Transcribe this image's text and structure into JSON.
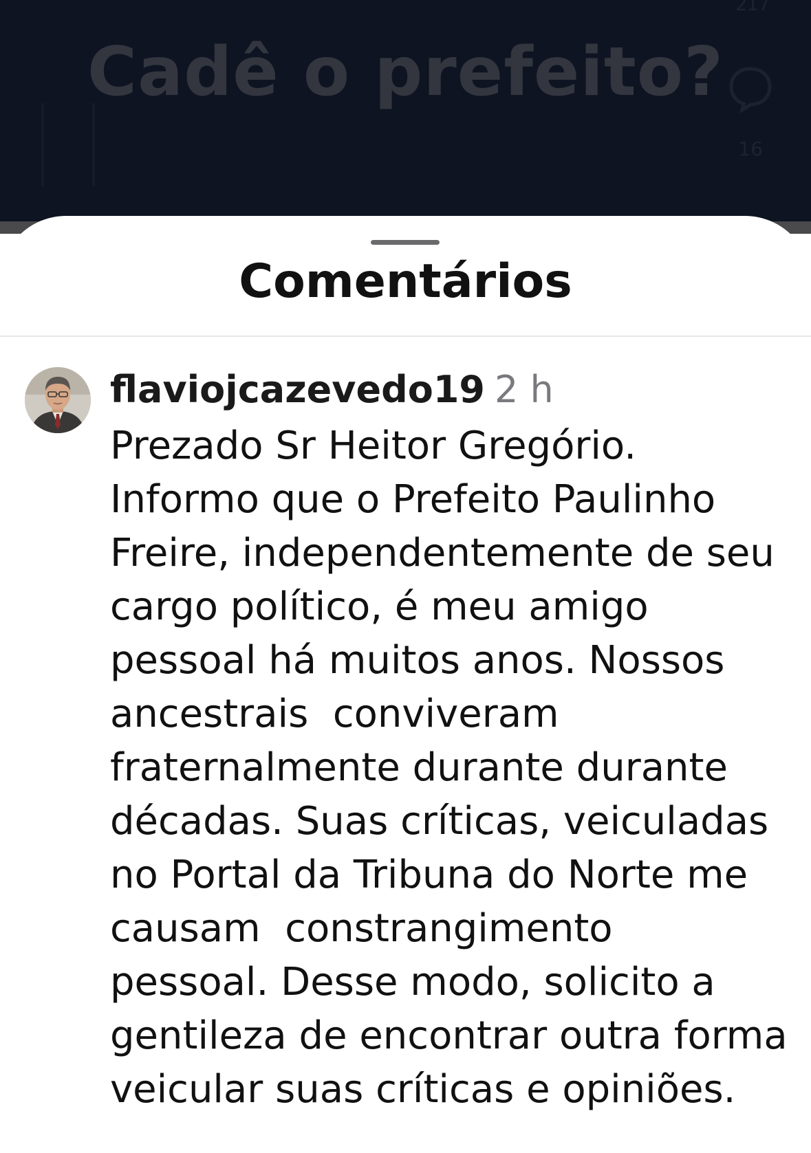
{
  "post": {
    "title": "Cadê o prefeito?",
    "count_top": "217",
    "count_bottom": "16",
    "comment_icon": "speech-bubble-icon"
  },
  "sheet": {
    "title": "Comentários"
  },
  "comment": {
    "username": "flaviojcazevedo19",
    "time": "2 h",
    "avatar": "user-photo-avatar",
    "lines": [
      "Prezado Sr Heitor Gregório.",
      "Informo que o Prefeito Paulinho",
      "Freire, independentemente de seu",
      "cargo político, é meu amigo",
      "pessoal há muitos anos. Nossos",
      "ancestrais  conviveram",
      "fraternalmente durante durante",
      "décadas. Suas críticas, veiculadas",
      "no Portal da Tribuna do Norte me",
      "causam  constrangimento",
      "pessoal. Desse modo, solicito a",
      "gentileza de encontrar outra forma",
      "veicular suas críticas e opiniões."
    ]
  },
  "colors": {
    "backdrop": "#0e1422",
    "text": "#111111",
    "muted": "#7a7a7e"
  }
}
